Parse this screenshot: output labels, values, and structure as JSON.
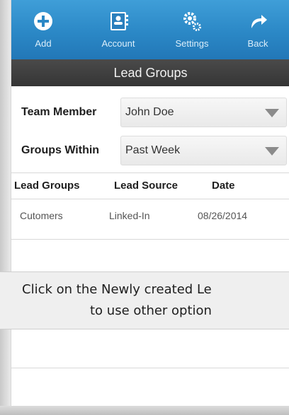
{
  "toolbar": {
    "items": [
      {
        "label": "Add",
        "icon": "plus-circle-icon"
      },
      {
        "label": "Account",
        "icon": "account-card-icon"
      },
      {
        "label": "Settings",
        "icon": "gears-icon"
      },
      {
        "label": "Back",
        "icon": "back-arrow-icon"
      }
    ],
    "colors": {
      "bar": "#2b88c6",
      "title_bar": "#3d3d3d"
    }
  },
  "page_title": "Lead Groups",
  "filters": {
    "team_member": {
      "label": "Team Member",
      "value": "John Doe"
    },
    "groups_within": {
      "label": "Groups Within",
      "value": "Past Week"
    }
  },
  "table": {
    "columns": [
      "Lead Groups",
      "Lead Source",
      "Date"
    ],
    "rows": [
      {
        "lead_group": "Cutomers",
        "lead_source": "Linked-In",
        "date": "08/26/2014"
      }
    ]
  },
  "callout": {
    "line1": "Click on the Newly created  Le",
    "line2": "to use other option"
  }
}
